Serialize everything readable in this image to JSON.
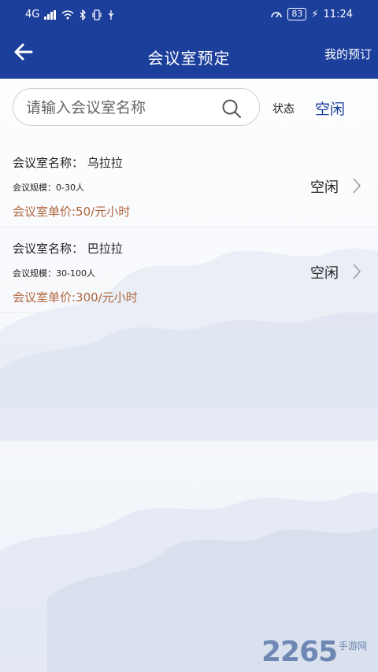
{
  "status_bar": {
    "signal_text": "4G",
    "battery": "83",
    "time": "11:24"
  },
  "header": {
    "title": "会议室预定",
    "my_booking_label": "我的预订"
  },
  "search": {
    "placeholder": "请输入会议室名称",
    "value": ""
  },
  "filter": {
    "status_label": "状态",
    "status_value": "空闲"
  },
  "rooms": [
    {
      "name": "会议室名称：  乌拉拉",
      "scale": "会议规模：0-30人",
      "price": "会议室单价:50/元小时",
      "status": "空闲"
    },
    {
      "name": "会议室名称：  巴拉拉",
      "scale": "会议规模：30-100人",
      "price": "会议室单价:300/元小时",
      "status": "空闲"
    }
  ],
  "watermark": {
    "logo": "2265",
    "sub": "手游网"
  },
  "colors": {
    "header_bg": "#1c3f9c",
    "price": "#b0663d",
    "accent": "#1c3f9c"
  }
}
